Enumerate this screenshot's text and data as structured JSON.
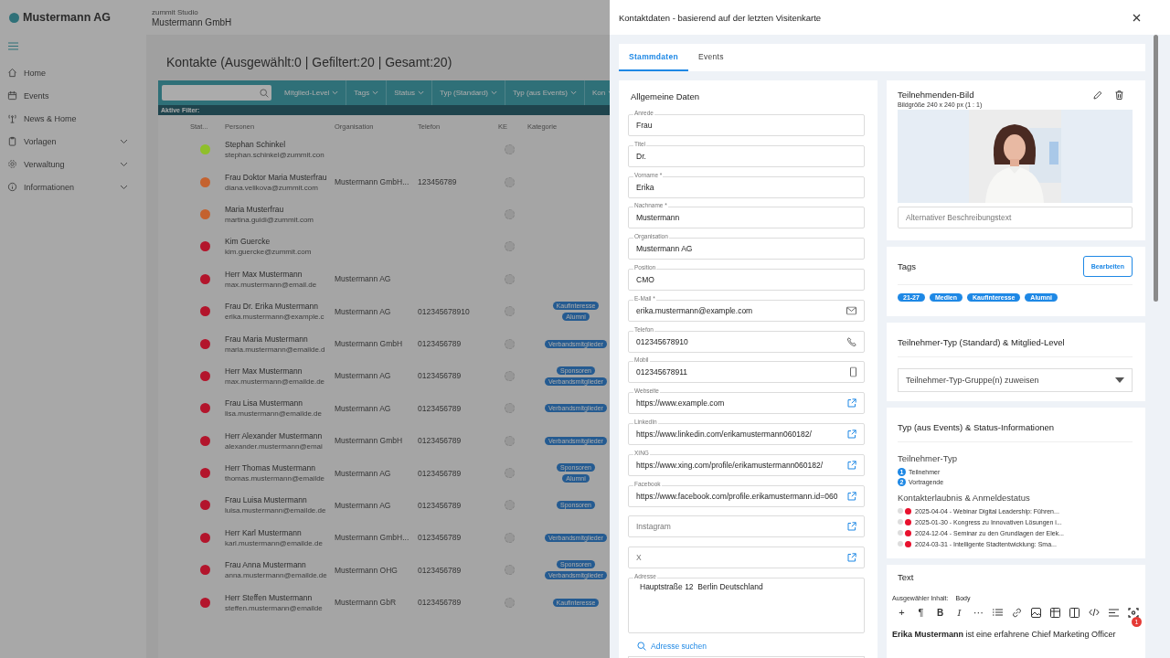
{
  "app": {
    "brand": "Mustermann AG",
    "studio": "zummit Studio",
    "organization": "Mustermann GmbH"
  },
  "sidebar": {
    "items": [
      {
        "label": "Home",
        "expandable": false
      },
      {
        "label": "Events",
        "expandable": false
      },
      {
        "label": "News & Home",
        "expandable": false
      },
      {
        "label": "Vorlagen",
        "expandable": true
      },
      {
        "label": "Verwaltung",
        "expandable": true
      },
      {
        "label": "Informationen",
        "expandable": true
      }
    ]
  },
  "page_title": "Kontakte (Ausgewählt:0 | Gefiltert:20 | Gesamt:20)",
  "filters": [
    "Mitglied-Level",
    "Tags",
    "Status",
    "Typ (Standard)",
    "Typ (aus Events)",
    "Kon"
  ],
  "active_filters_label": "Aktive Filter:",
  "table": {
    "columns": [
      "Stat...",
      "Personen",
      "Organisation",
      "Telefon",
      "KE",
      "Kategorie"
    ],
    "rows": [
      {
        "color": "#8fbf2a",
        "name": "Stephan Schinkel",
        "email": "stephan.schinkel@zummit.con"
      },
      {
        "color": "#c4622f",
        "name": "Frau Doktor Maria Musterfrau",
        "email": "diana.velikova@zummit.com",
        "organisation": "Mustermann GmbH...",
        "phone": "123456789"
      },
      {
        "color": "#c4622f",
        "name": "Maria Musterfrau",
        "email": "martina.guidi@zummit.com"
      },
      {
        "color": "#b3152c",
        "name": "Kim Guercke",
        "email": "kim.guercke@zummit.com"
      },
      {
        "color": "#b3152c",
        "name": "Herr Max Mustermann",
        "email": "max.mustermann@email.de",
        "organisation": "Mustermann AG"
      },
      {
        "color": "#b3152c",
        "name": "Frau Dr. Erika Mustermann",
        "email": "erika.mustermann@example.c",
        "organisation": "Mustermann AG",
        "phone": "012345678910",
        "tags": [
          "Kaufinteresse",
          "Alumni"
        ]
      },
      {
        "color": "#b3152c",
        "name": "Frau Maria Mustermann",
        "email": "maria.mustermann@emailde.d",
        "organisation": "Mustermann GmbH",
        "phone": "0123456789",
        "tags": [
          "Verbandsmitglieder"
        ]
      },
      {
        "color": "#b3152c",
        "name": "Herr Max Mustermann",
        "email": "max.mustermann@emailde.de",
        "organisation": "Mustermann AG",
        "phone": "0123456789",
        "tags": [
          "Sponsoren",
          "Verbandsmitglieder"
        ]
      },
      {
        "color": "#b3152c",
        "name": "Frau Lisa Mustermann",
        "email": "lisa.mustermann@emailde.de",
        "organisation": "Mustermann AG",
        "phone": "0123456789",
        "tags": [
          "Verbandsmitglieder"
        ]
      },
      {
        "color": "#b3152c",
        "name": "Herr Alexander Mustermann",
        "email": "alexander.mustermann@emai",
        "organisation": "Mustermann GmbH",
        "phone": "0123456789",
        "tags": [
          "Verbandsmitglieder"
        ]
      },
      {
        "color": "#b3152c",
        "name": "Herr Thomas Mustermann",
        "email": "thomas.mustermann@emailde",
        "organisation": "Mustermann AG",
        "phone": "0123456789",
        "tags": [
          "Sponsoren",
          "Alumni"
        ]
      },
      {
        "color": "#b3152c",
        "name": "Frau Luisa Mustermann",
        "email": "luisa.mustermann@emailde.de",
        "organisation": "Mustermann AG",
        "phone": "0123456789",
        "tags": [
          "Sponsoren"
        ]
      },
      {
        "color": "#b3152c",
        "name": "Herr Karl Mustermann",
        "email": "karl.mustermann@emailde.de",
        "organisation": "Mustermann GmbH...",
        "phone": "0123456789",
        "tags": [
          "Verbandsmitglieder"
        ]
      },
      {
        "color": "#b3152c",
        "name": "Frau Anna Mustermann",
        "email": "anna.mustermann@emailde.de",
        "organisation": "Mustermann OHG",
        "phone": "0123456789",
        "tags": [
          "Sponsoren",
          "Verbandsmitglieder"
        ]
      },
      {
        "color": "#b3152c",
        "name": "Herr Steffen Mustermann",
        "email": "steffen.mustermann@emailde",
        "organisation": "Mustermann GbR",
        "phone": "0123456789",
        "tags": [
          "Kaufinteresse"
        ]
      }
    ]
  },
  "drawer": {
    "title": "Kontaktdaten - basierend auf der letzten Visitenkarte",
    "tabs": [
      {
        "label": "Stammdaten",
        "selected": true
      },
      {
        "label": "Events",
        "selected": false
      }
    ],
    "general": {
      "title": "Allgemeine Daten",
      "fields": [
        {
          "label": "Anrede",
          "value": "Frau",
          "kind": "text"
        },
        {
          "label": "Titel",
          "value": "Dr.",
          "kind": "text"
        },
        {
          "label": "Vorname *",
          "value": "Erika",
          "kind": "text"
        },
        {
          "label": "Nachname *",
          "value": "Mustermann",
          "kind": "text"
        },
        {
          "label": "Organisation",
          "value": "Mustermann AG",
          "kind": "text"
        },
        {
          "label": "Position",
          "value": "CMO",
          "kind": "text"
        },
        {
          "label": "E-Mail *",
          "value": "erika.mustermann@example.com",
          "kind": "email"
        },
        {
          "label": "Telefon",
          "value": "012345678910",
          "kind": "tel"
        },
        {
          "label": "Mobil",
          "value": "012345678911",
          "kind": "mobile"
        },
        {
          "label": "Webseite",
          "value": "https://www.example.com",
          "kind": "url"
        },
        {
          "label": "LinkedIn",
          "value": "https://www.linkedin.com/erikamustermann060182/",
          "kind": "url"
        },
        {
          "label": "XING",
          "value": "https://www.xing.com/profile/erikamustermann060182/",
          "kind": "url"
        },
        {
          "label": "Facebook",
          "value": "https://www.facebook.com/profile.erikamustermann.id=060",
          "kind": "url"
        },
        {
          "placeholder": "Instagram",
          "kind": "url"
        },
        {
          "placeholder": "X",
          "kind": "url"
        },
        {
          "label": "Adresse",
          "value": "Hauptstraße 12  Berlin Deutschland",
          "kind": "textarea"
        }
      ],
      "address_search": "Adresse suchen"
    },
    "image": {
      "title": "Teilnehmenden-Bild",
      "size_hint": "Bildgröße 240 x 240 px (1 : 1)",
      "alt_placeholder": "Alternativer Beschreibungstext"
    },
    "tags": {
      "title": "Tags",
      "edit_button": "Bearbeiten",
      "items": [
        "21-27",
        "Medien",
        "Kaufinteresse",
        "Alumni"
      ]
    },
    "type_standard": {
      "title": "Teilnehmer-Typ (Standard) & Mitglied-Level",
      "select_placeholder": "Teilnehmer-Typ-Gruppe(n) zuweisen"
    },
    "type_events": {
      "title": "Typ (aus Events) & Status-Informationen",
      "participant_type_heading": "Teilnehmer-Typ",
      "participant_types": [
        {
          "number": "1",
          "label": "Teilnehmer"
        },
        {
          "number": "2",
          "label": "Vortragende"
        }
      ],
      "status_heading": "Kontakterlaubnis & Anmeldestatus",
      "events": [
        {
          "color": "#e8112d",
          "label": "2025-04-04 - Webinar Digital Leadership: Führen..."
        },
        {
          "color": "#e8112d",
          "label": "2025-01-30 - Kongress zu Innovativen Lösungen i..."
        },
        {
          "color": "#e8112d",
          "label": "2024-12-04 - Seminar zu den Grundlagen der Elek..."
        },
        {
          "color": "#e8112d",
          "label": "2024-03-31 - Intelligente Stadtentwicklung: Sma..."
        }
      ]
    },
    "text": {
      "title": "Text",
      "selected_label": "Ausgewähler Inhalt:",
      "selected_value": "Body",
      "toolbar_glyphs": [
        "+",
        "¶",
        "B",
        "I",
        "⋯"
      ],
      "content": "**Erika Mustermann** ist eine erfahrene Chief Marketing Officer",
      "issue_count": "1"
    }
  }
}
